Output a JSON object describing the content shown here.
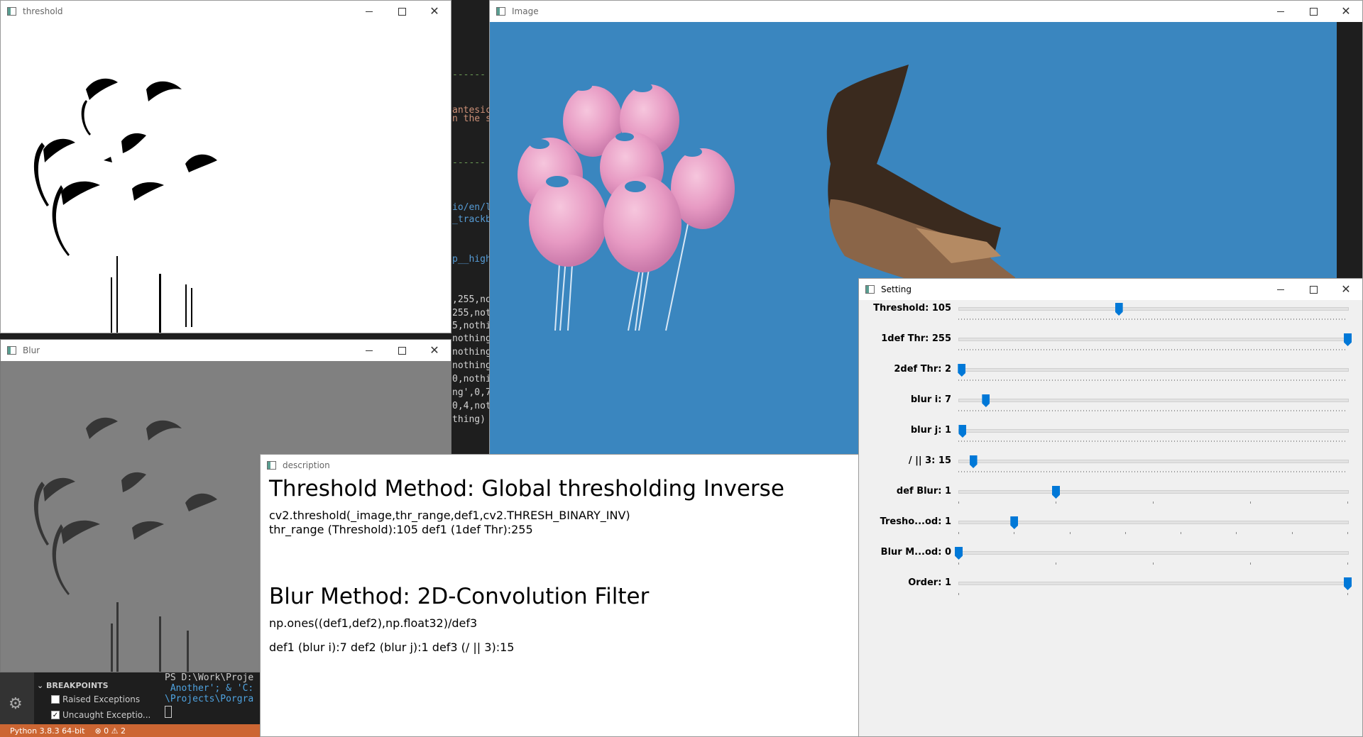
{
  "windows": {
    "threshold": {
      "title": "threshold"
    },
    "blur": {
      "title": "Blur"
    },
    "image": {
      "title": "Image"
    },
    "description": {
      "title": "description"
    },
    "setting": {
      "title": "Setting"
    }
  },
  "editor_lines": [
    "------",
    "antesic",
    "n the s",
    "",
    "------",
    "",
    "io/en/l",
    "_trackb",
    "",
    "p__high",
    "",
    ",255,no",
    "255,not",
    "5,nothi",
    "nothing",
    "nothing",
    "nothing",
    "0,nothi",
    "ng',0,7",
    "0,4,not",
    "thing)"
  ],
  "vscode": {
    "breakpoints_header": "BREAKPOINTS",
    "raised_exceptions": "Raised Exceptions",
    "uncaught_exceptions": "Uncaught Exceptio...",
    "terminal_lines": [
      "PS D:\\Work\\Proje",
      " Another'; & 'C:",
      "\\Projects\\Porgra"
    ],
    "status_python": "Python 3.8.3 64-bit",
    "status_problems": "⊗ 0 ⚠ 2"
  },
  "settings": {
    "trackbars": [
      {
        "label": "Threshold: 105",
        "value": 105,
        "max": 255
      },
      {
        "label": "1def Thr: 255",
        "value": 255,
        "max": 255
      },
      {
        "label": "2def Thr: 2",
        "value": 2,
        "max": 255
      },
      {
        "label": "blur i: 7",
        "value": 7,
        "max": 100
      },
      {
        "label": "blur j: 1",
        "value": 1,
        "max": 100
      },
      {
        "label": "/ || 3: 15",
        "value": 15,
        "max": 400
      },
      {
        "label": "def Blur: 1",
        "value": 1,
        "max": 4
      },
      {
        "label": "Tresho...od: 1",
        "value": 1,
        "max": 7
      },
      {
        "label": "Blur M...od: 0",
        "value": 0,
        "max": 4
      },
      {
        "label": "Order: 1",
        "value": 1,
        "max": 1
      }
    ]
  },
  "description": {
    "threshold_heading": "Threshold Method: Global thresholding Inverse",
    "threshold_code": "cv2.threshold(_image,thr_range,def1,cv2.THRESH_BINARY_INV)",
    "threshold_params": "thr_range (Threshold):105 def1 (1def Thr):255",
    "blur_heading": "Blur Method: 2D-Convolution Filter",
    "blur_code": "np.ones((def1,def2),np.float32)/def3",
    "blur_params": "def1 (blur i):7 def2 (blur j):1 def3 (/ || 3):15"
  },
  "colors": {
    "sky": "#3a86bf",
    "balloon": "#e79ac3",
    "thumb": "#0078d7",
    "status": "#cc6633"
  }
}
